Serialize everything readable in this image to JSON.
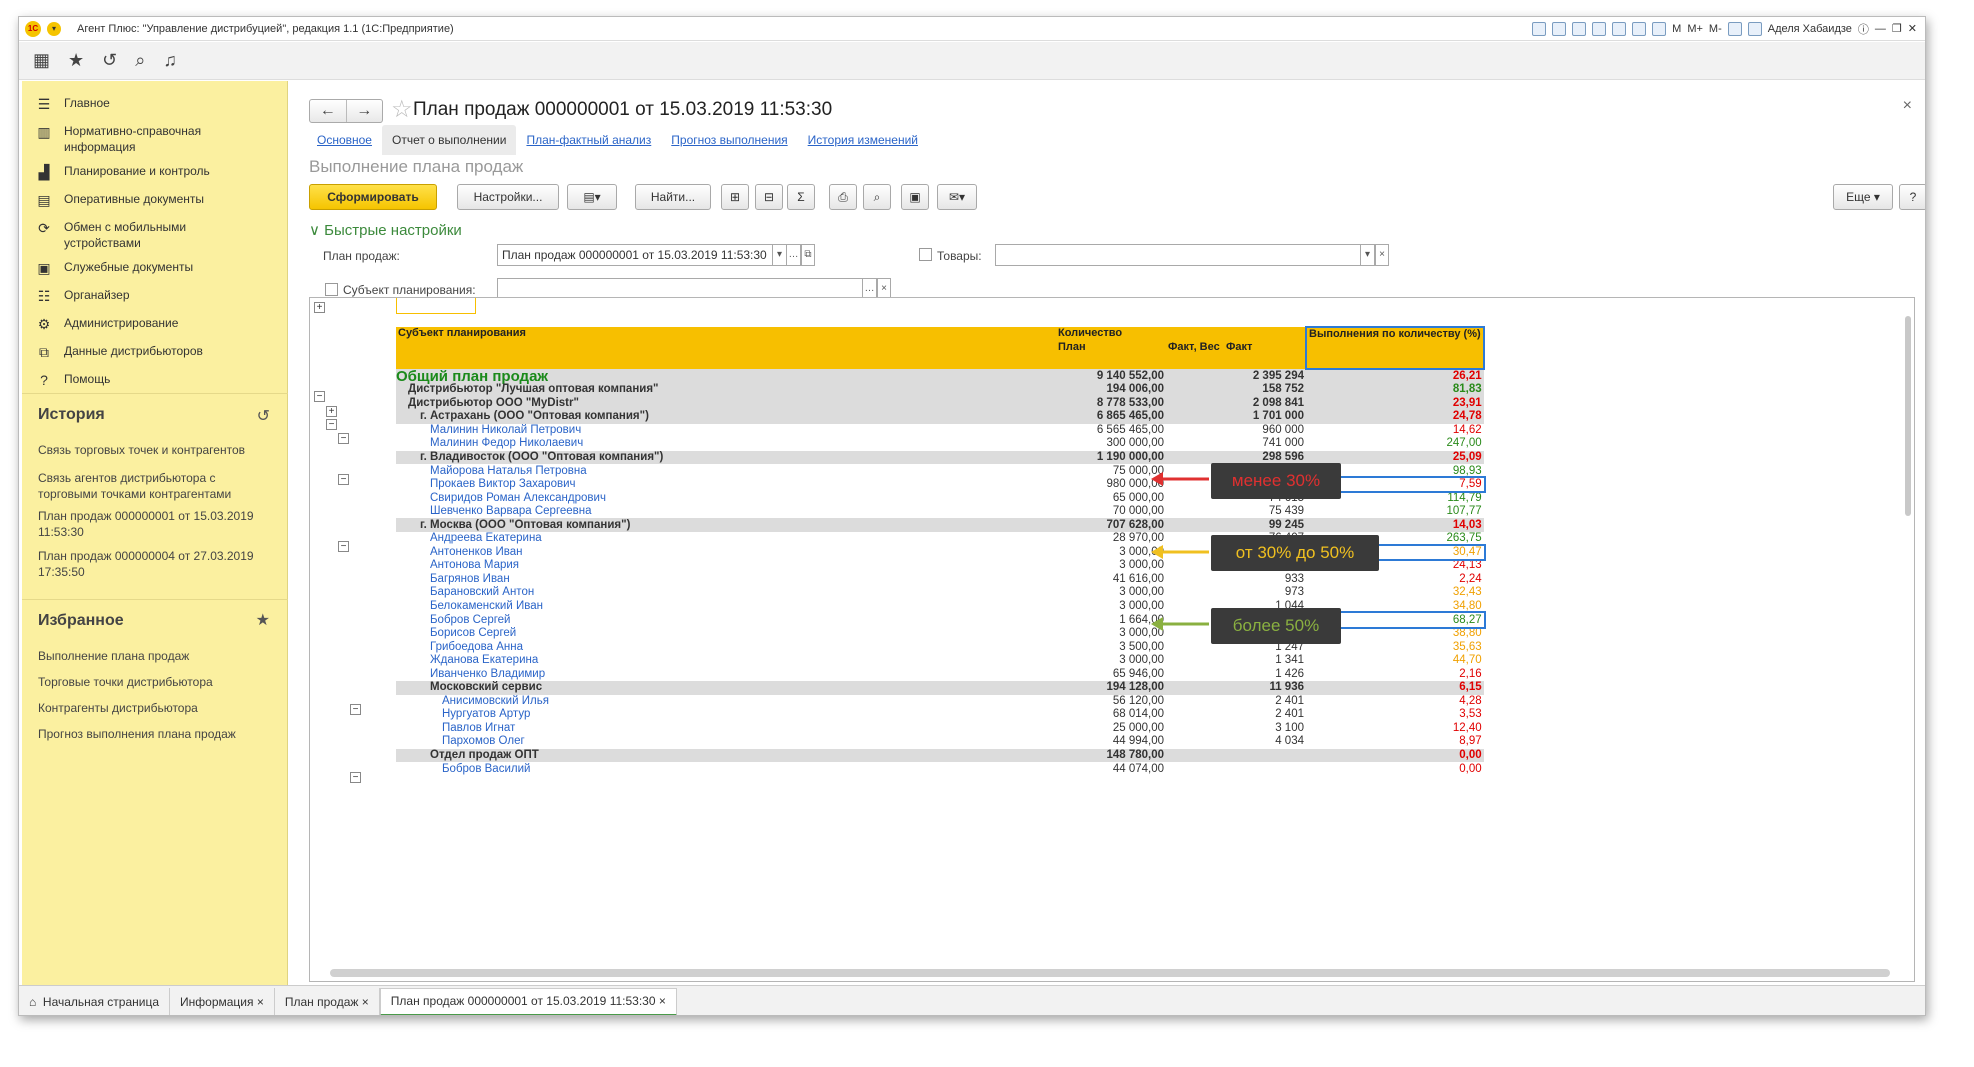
{
  "window": {
    "title": "Агент Плюс: \"Управление дистрибуцией\", редакция 1.1 (1С:Предприятие)",
    "user": "Аделя Хабаидзе"
  },
  "sidebar": {
    "items": [
      {
        "label": "Главное",
        "icon": "menu-icon"
      },
      {
        "label": "Нормативно-справочная информация",
        "icon": "catalog-icon"
      },
      {
        "label": "Планирование и контроль",
        "icon": "chart-icon"
      },
      {
        "label": "Оперативные документы",
        "icon": "documents-icon"
      },
      {
        "label": "Обмен с мобильными устройствами",
        "icon": "sync-icon"
      },
      {
        "label": "Служебные документы",
        "icon": "service-docs-icon"
      },
      {
        "label": "Органайзер",
        "icon": "organizer-icon"
      },
      {
        "label": "Администрирование",
        "icon": "gear-icon"
      },
      {
        "label": "Данные дистрибьюторов",
        "icon": "distributor-data-icon"
      },
      {
        "label": "Помощь",
        "icon": "help-icon"
      }
    ],
    "history": {
      "title": "История",
      "links": [
        "Связь торговых точек и контрагентов",
        "Связь агентов дистрибьютора с торговыми точками контрагентами",
        "План продаж 000000001 от 15.03.2019 11:53:30",
        "План продаж 000000004 от 27.03.2019 17:35:50"
      ]
    },
    "favorites": {
      "title": "Избранное",
      "links": [
        "Выполнение плана продаж",
        "Торговые точки дистрибьютора",
        "Контрагенты дистрибьютора",
        "Прогноз выполнения плана продаж"
      ]
    }
  },
  "main": {
    "doc_title": "План продаж 000000001 от 15.03.2019 11:53:30",
    "tabs": [
      "Основное",
      "Отчет о выполнении",
      "План-фактный анализ",
      "Прогноз выполнения",
      "История изменений"
    ],
    "section_title": "Выполнение плана продаж",
    "buttons": {
      "generate": "Сформировать",
      "settings": "Настройки...",
      "find": "Найти...",
      "more": "Еще",
      "help": "?"
    },
    "quick_settings": "Быстрые настройки",
    "filters": {
      "plan_label": "План продаж:",
      "plan_value": "План продаж 000000001 от 15.03.2019 11:53:30",
      "goods_label": "Товары:",
      "subject_label": "Субъект планирования:"
    }
  },
  "report": {
    "headers": {
      "subject": "Субъект планирования",
      "quantity": "Количество",
      "plan": "План",
      "fact_weight": "Факт, Вес",
      "fact": "Факт",
      "percent": "Выполнения по количеству (%)"
    },
    "rows": [
      {
        "name": "Общий план продаж",
        "plan": "9 140 552,00",
        "fact": "2 395 294",
        "pct": "26,21",
        "color": "red",
        "type": "total"
      },
      {
        "name": "Дистрибьютор \"Лучшая оптовая компания\"",
        "plan": "194 006,00",
        "fact": "158 752",
        "pct": "81,83",
        "color": "green",
        "type": "dist"
      },
      {
        "name": "Дистрибьютор ООО \"MyDistr\"",
        "plan": "8 778 533,00",
        "fact": "2 098 841",
        "pct": "23,91",
        "color": "red",
        "type": "dist"
      },
      {
        "name": "г. Астрахань (ООО \"Оптовая компания\")",
        "plan": "6 865 465,00",
        "fact": "1 701 000",
        "pct": "24,78",
        "color": "red",
        "type": "grp"
      },
      {
        "name": "Малинин Николай Петрович",
        "plan": "6 565 465,00",
        "fact": "960 000",
        "pct": "14,62",
        "color": "red",
        "type": "item"
      },
      {
        "name": "Малинин Федор Николаевич",
        "plan": "300 000,00",
        "fact": "741 000",
        "pct": "247,00",
        "color": "green",
        "type": "item"
      },
      {
        "name": "г. Владивосток (ООО \"Оптовая компания\")",
        "plan": "1 190 000,00",
        "fact": "298 596",
        "pct": "25,09",
        "color": "red",
        "type": "grp"
      },
      {
        "name": "Майорова Наталья Петровна",
        "plan": "75 000,00",
        "fact": "74 199",
        "pct": "98,93",
        "color": "green",
        "type": "item"
      },
      {
        "name": "Прокаев Виктор Захарович",
        "plan": "980 000,00",
        "fact": "74 343",
        "pct": "7,59",
        "color": "red",
        "type": "item"
      },
      {
        "name": "Свиридов Роман Александрович",
        "plan": "65 000,00",
        "fact": "74 615",
        "pct": "114,79",
        "color": "green",
        "type": "item"
      },
      {
        "name": "Шевченко Варвара Сергеевна",
        "plan": "70 000,00",
        "fact": "75 439",
        "pct": "107,77",
        "color": "green",
        "type": "item"
      },
      {
        "name": "г. Москва (ООО \"Оптовая компания\")",
        "plan": "707 628,00",
        "fact": "99 245",
        "pct": "14,03",
        "color": "red",
        "type": "grp"
      },
      {
        "name": "Андреева Екатерина",
        "plan": "28 970,00",
        "fact": "76 407",
        "pct": "263,75",
        "color": "green",
        "type": "item"
      },
      {
        "name": "Антоненков Иван",
        "plan": "3 000,00",
        "fact": "914",
        "pct": "30,47",
        "color": "orange",
        "type": "item"
      },
      {
        "name": "Антонова Мария",
        "plan": "3 000,00",
        "fact": "724",
        "pct": "24,13",
        "color": "red",
        "type": "item"
      },
      {
        "name": "Багрянов Иван",
        "plan": "41 616,00",
        "fact": "933",
        "pct": "2,24",
        "color": "red",
        "type": "item"
      },
      {
        "name": "Барановский Антон",
        "plan": "3 000,00",
        "fact": "973",
        "pct": "32,43",
        "color": "orange",
        "type": "item"
      },
      {
        "name": "Белокаменский Иван",
        "plan": "3 000,00",
        "fact": "1 044",
        "pct": "34,80",
        "color": "orange",
        "type": "item"
      },
      {
        "name": "Бобров Сергей",
        "plan": "1 664,00",
        "fact": "1 136",
        "pct": "68,27",
        "color": "green",
        "type": "item"
      },
      {
        "name": "Борисов Сергей",
        "plan": "3 000,00",
        "fact": "1 164",
        "pct": "38,80",
        "color": "orange",
        "type": "item"
      },
      {
        "name": "Грибоедова Анна",
        "plan": "3 500,00",
        "fact": "1 247",
        "pct": "35,63",
        "color": "orange",
        "type": "item"
      },
      {
        "name": "Жданова Екатерина",
        "plan": "3 000,00",
        "fact": "1 341",
        "pct": "44,70",
        "color": "orange",
        "type": "item"
      },
      {
        "name": "Иванченко Владимир",
        "plan": "65 946,00",
        "fact": "1 426",
        "pct": "2,16",
        "color": "red",
        "type": "item"
      },
      {
        "name": "Московский сервис",
        "plan": "194 128,00",
        "fact": "11 936",
        "pct": "6,15",
        "color": "red",
        "type": "sub"
      },
      {
        "name": "Анисимовский Илья",
        "plan": "56 120,00",
        "fact": "2 401",
        "pct": "4,28",
        "color": "red",
        "type": "item2"
      },
      {
        "name": "Нургуатов Артур",
        "plan": "68 014,00",
        "fact": "2 401",
        "pct": "3,53",
        "color": "red",
        "type": "item2"
      },
      {
        "name": "Павлов Игнат",
        "plan": "25 000,00",
        "fact": "3 100",
        "pct": "12,40",
        "color": "red",
        "type": "item2"
      },
      {
        "name": "Пархомов Олег",
        "plan": "44 994,00",
        "fact": "4 034",
        "pct": "8,97",
        "color": "red",
        "type": "item2"
      },
      {
        "name": "Отдел продаж ОПТ",
        "plan": "148 780,00",
        "fact": "",
        "pct": "0,00",
        "color": "red",
        "type": "sub"
      },
      {
        "name": "Бобров Василий",
        "plan": "44 074,00",
        "fact": "",
        "pct": "0,00",
        "color": "red",
        "type": "item2"
      }
    ]
  },
  "callouts": [
    {
      "text": "менее 30%",
      "color": "#e03030"
    },
    {
      "text": "от 30% до 50%",
      "color": "#f0c020"
    },
    {
      "text": "более 50%",
      "color": "#8ab040"
    }
  ],
  "bottom_tabs": [
    "Начальная страница",
    "Информация",
    "План продаж",
    "План продаж 000000001 от 15.03.2019 11:53:30"
  ]
}
